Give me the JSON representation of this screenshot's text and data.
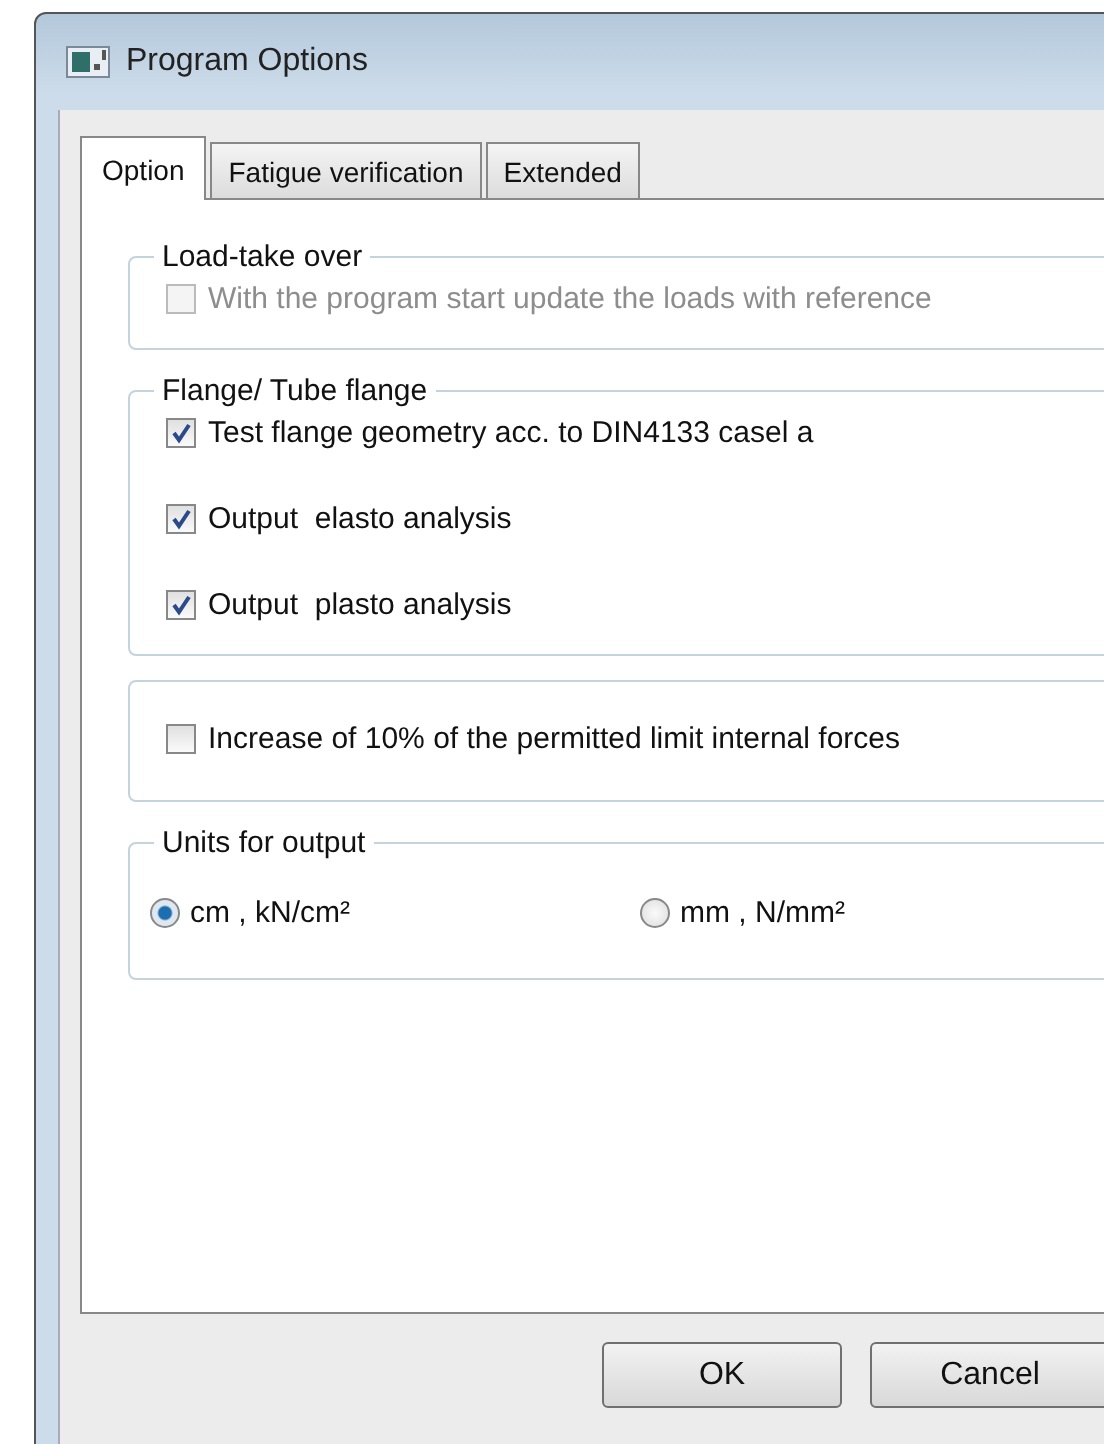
{
  "window": {
    "title": "Program Options"
  },
  "tabs": [
    {
      "label": "Option",
      "selected": true
    },
    {
      "label": "Fatigue verification",
      "selected": false
    },
    {
      "label": "Extended",
      "selected": false
    }
  ],
  "groups": [
    {
      "kind": "checks",
      "title": "Load-take over",
      "items": [
        {
          "label": "With the program start update the loads with reference",
          "checked": false,
          "disabled": true
        }
      ]
    },
    {
      "kind": "checks",
      "title": "Flange/ Tube flange",
      "items": [
        {
          "label": "Test flange geometry acc. to DIN4133 casel a",
          "checked": true,
          "disabled": false
        },
        {
          "label": "Output  elasto analysis",
          "checked": true,
          "disabled": false
        },
        {
          "label": "Output  plasto analysis",
          "checked": true,
          "disabled": false
        }
      ]
    },
    {
      "kind": "checks",
      "items": [
        {
          "label": "Increase of 10% of the permitted limit internal forces",
          "checked": false,
          "disabled": false
        }
      ]
    },
    {
      "kind": "radios",
      "title": "Units for output",
      "items": [
        {
          "label": "cm , kN/cm²",
          "selected": true
        },
        {
          "label": "mm , N/mm²",
          "selected": false
        }
      ]
    }
  ],
  "buttons": [
    "OK",
    "Cancel"
  ]
}
